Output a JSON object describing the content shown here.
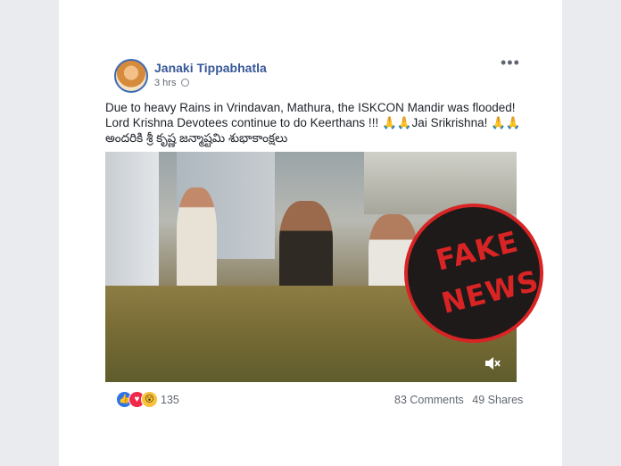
{
  "post": {
    "author": "Janaki Tippabhatla",
    "time": "3 hrs",
    "text_lines": [
      "Due to heavy Rains in Vrindavan, Mathura, the ISKCON Mandir was flooded!",
      "Lord Krishna Devotees continue to do Keerthans !!! 🙏🙏Jai Srikrishna! 🙏🙏",
      "అందరికి శ్రీ కృష్ణ జన్మాష్టమి శుభాకాంక్షలు"
    ],
    "badge_line1": "FAKE",
    "badge_line2": "NEWS",
    "reaction_count": "135",
    "comments": "83 Comments",
    "shares": "49 Shares"
  },
  "colors": {
    "author_link": "#385898",
    "badge_red": "#d82424",
    "page_bg": "#e9ebee"
  },
  "icons": {
    "more": "more-options-icon",
    "privacy": "globe-icon",
    "mute": "speaker-muted-icon"
  }
}
